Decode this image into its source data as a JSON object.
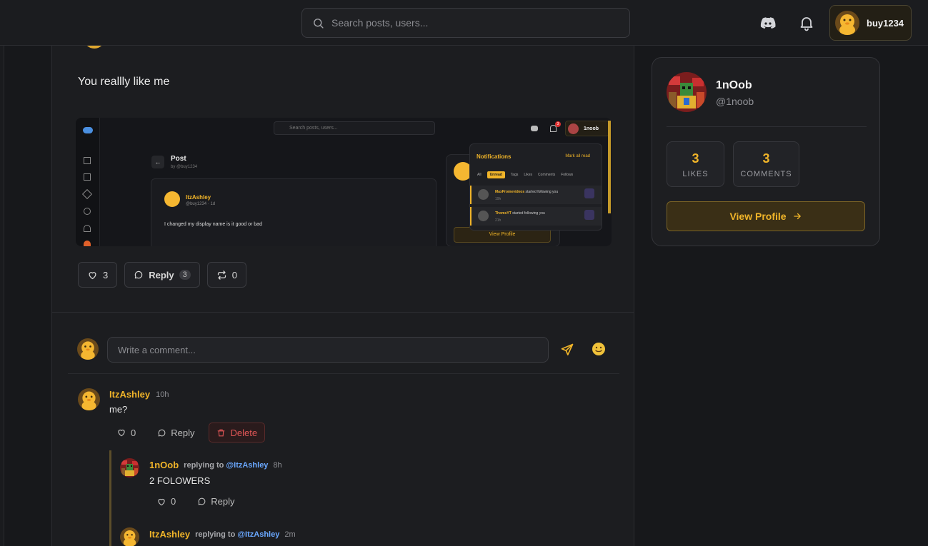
{
  "topbar": {
    "search_placeholder": "Search posts, users...",
    "username": "buy1234"
  },
  "post": {
    "text": "You reallly like me",
    "likes": "3",
    "reply_label": "Reply",
    "reply_count": "3",
    "reposts": "0"
  },
  "screenshot": {
    "search_placeholder": "Search posts, users...",
    "user": "1noob",
    "badge": "3",
    "page_title": "Post",
    "page_by": "by @buy1234",
    "post_author": "ItzAshley",
    "post_meta": "@buy1234 · 1d",
    "post_body": "I changed my display name is it good or bad",
    "notifications": {
      "title": "Notifications",
      "mark_all": "Mark all read",
      "tabs": [
        "All",
        "Unread",
        "Tags",
        "Likes",
        "Comments",
        "Follows"
      ],
      "items": [
        {
          "user": "MaxPromevideos",
          "text": "started following you",
          "time": "19h"
        },
        {
          "user": "ThomsYT",
          "text": "started following you",
          "time": "21h"
        }
      ]
    },
    "view_profile": "View Profile"
  },
  "composer": {
    "placeholder": "Write a comment..."
  },
  "comments": [
    {
      "author": "ItzAshley",
      "time": "10h",
      "body": "me?",
      "likes": "0",
      "reply_label": "Reply",
      "delete_label": "Delete"
    }
  ],
  "replies": [
    {
      "author": "1nOob",
      "replying_prefix": "replying to",
      "replying_to": "@ItzAshley",
      "time": "8h",
      "body": "2 FOLOWERS",
      "likes": "0",
      "reply_label": "Reply"
    },
    {
      "author": "ItzAshley",
      "replying_prefix": "replying to",
      "replying_to": "@ItzAshley",
      "time": "2m"
    }
  ],
  "profile": {
    "name": "1nOob",
    "handle": "@1noob",
    "likes_count": "3",
    "likes_label": "LIKES",
    "comments_count": "3",
    "comments_label": "COMMENTS",
    "view_profile": "View Profile"
  },
  "colors": {
    "accent": "#f0b429",
    "mention": "#6aa8ff",
    "danger": "#e05656",
    "background": "#17181b"
  }
}
